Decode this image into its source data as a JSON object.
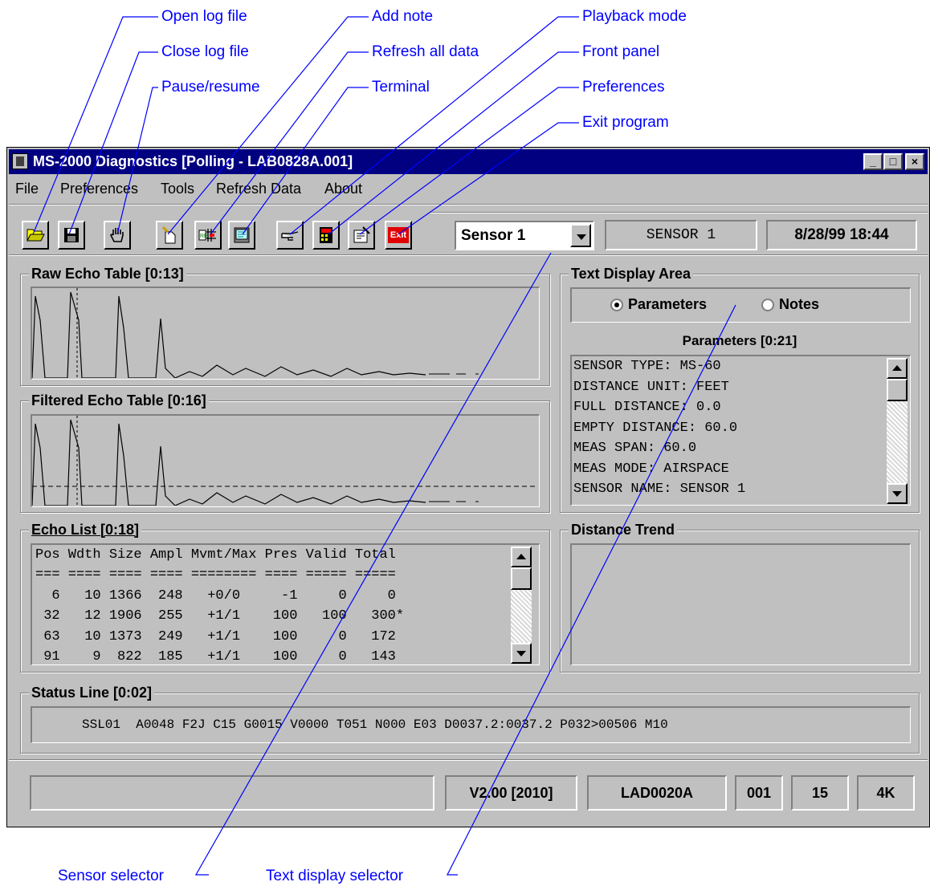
{
  "callouts": {
    "open_log": "Open log file",
    "close_log": "Close log file",
    "pause_resume": "Pause/resume",
    "add_note": "Add note",
    "refresh_all": "Refresh all data",
    "terminal": "Terminal",
    "playback": "Playback mode",
    "front_panel": "Front panel",
    "preferences": "Preferences",
    "exit_program": "Exit program",
    "sensor_selector": "Sensor selector",
    "text_display_selector": "Text display selector"
  },
  "window": {
    "title": "MS-2000 Diagnostics [Polling - LAB0828A.001]",
    "controls": {
      "minimize": "_",
      "maximize": "□",
      "close": "×"
    }
  },
  "menu": {
    "file": "File",
    "preferences": "Preferences",
    "tools": "Tools",
    "refresh_data": "Refresh Data",
    "about": "About"
  },
  "toolbar": {
    "buttons": [
      "open-log",
      "close-log",
      "pause-resume",
      "add-note",
      "refresh-data",
      "terminal",
      "playback-mode",
      "front-panel",
      "preferences",
      "exit"
    ],
    "exit_label": "Exit",
    "sensor_select": "Sensor 1",
    "sensor_name": "SENSOR 1",
    "datetime": "8/28/99 18:44"
  },
  "raw_echo": {
    "title": "Raw Echo Table [0:13]"
  },
  "filtered_echo": {
    "title": "Filtered Echo Table [0:16]"
  },
  "echo_list": {
    "title": "Echo List [0:18]",
    "header": "Pos Wdth Size Ampl Mvmt/Max Pres Valid Total",
    "rule": "=== ==== ==== ==== ======== ==== ===== =====",
    "rows": [
      "  6   10 1366  248   +0/0     -1     0     0",
      " 32   12 1906  255   +1/1    100   100   300*",
      " 63   10 1373  249   +1/1    100     0   172",
      " 91    9  822  185   +1/1    100     0   143"
    ]
  },
  "text_display": {
    "title": "Text Display Area",
    "opt_parameters": "Parameters",
    "opt_notes": "Notes",
    "params_title": "Parameters [0:21]",
    "params": [
      "SENSOR TYPE: MS-60",
      "DISTANCE UNIT: FEET",
      "FULL DISTANCE: 0.0",
      "EMPTY DISTANCE: 60.0",
      "MEAS SPAN: 60.0",
      "MEAS MODE: AIRSPACE",
      "SENSOR NAME: SENSOR 1"
    ]
  },
  "distance_trend": {
    "title": "Distance Trend"
  },
  "status_line": {
    "title": "Status Line [0:02]",
    "text": "SSL01  A0048 F2J C15 G0015 V0000 T051 N000 E03 D0037.2:0037.2 P032>00506 M10"
  },
  "statusbar": {
    "version": "V2.00 [2010]",
    "file": "LAD0020A",
    "seq": "001",
    "count": "15",
    "mem": "4K"
  },
  "colors": {
    "callout": "#0000ff",
    "titlebar": "#000080",
    "face": "#c0c0c0",
    "exit_button": "#e00000"
  }
}
